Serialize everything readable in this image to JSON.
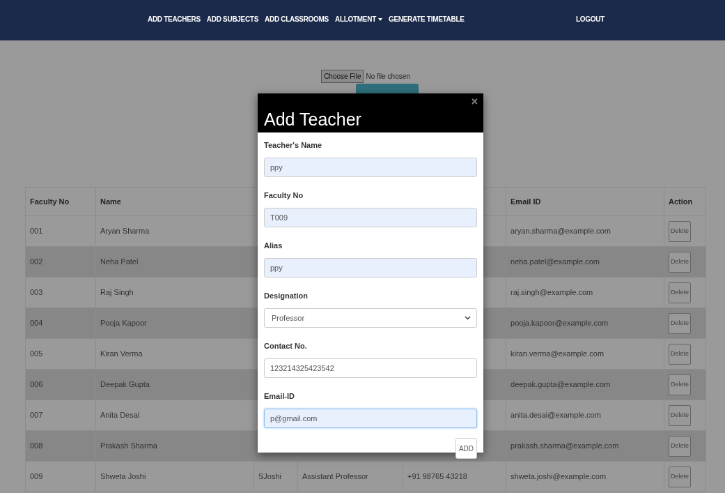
{
  "nav": {
    "items": [
      {
        "label": "ADD TEACHERS",
        "dropdown": false
      },
      {
        "label": "ADD SUBJECTS",
        "dropdown": false
      },
      {
        "label": "ADD CLASSROOMS",
        "dropdown": false
      },
      {
        "label": "ALLOTMENT",
        "dropdown": true
      },
      {
        "label": "GENERATE TIMETABLE",
        "dropdown": false
      }
    ],
    "logout": "LOGOUT"
  },
  "file_upload": {
    "button": "Choose File",
    "status": "No file chosen"
  },
  "table": {
    "columns": [
      "Faculty No",
      "Name",
      "Email ID",
      "Action"
    ],
    "rows": [
      {
        "faculty_no": "001",
        "name": "Aryan Sharma",
        "email": "aryan.sharma@example.com",
        "action": "Delete"
      },
      {
        "faculty_no": "002",
        "name": "Neha Patel",
        "email": "neha.patel@example.com",
        "action": "Delete"
      },
      {
        "faculty_no": "003",
        "name": "Raj Singh",
        "email": "raj.singh@example.com",
        "action": "Delete"
      },
      {
        "faculty_no": "004",
        "name": "Pooja Kapoor",
        "email": "pooja.kapoor@example.com",
        "action": "Delete"
      },
      {
        "faculty_no": "005",
        "name": "Kiran Verma",
        "email": "kiran.verma@example.com",
        "action": "Delete"
      },
      {
        "faculty_no": "006",
        "name": "Deepak Gupta",
        "email": "deepak.gupta@example.com",
        "action": "Delete"
      },
      {
        "faculty_no": "007",
        "name": "Anita Desai",
        "email": "anita.desai@example.com",
        "action": "Delete"
      },
      {
        "faculty_no": "008",
        "name": "Prakash Sharma",
        "email": "prakash.sharma@example.com",
        "action": "Delete"
      },
      {
        "faculty_no": "009",
        "name": "Shweta Joshi",
        "alias": "SJoshi",
        "designation": "Assistant Professor",
        "contact": "+91 98765 43218",
        "email": "shweta.joshi@example.com",
        "action": "Delete"
      }
    ]
  },
  "modal": {
    "title": "Add Teacher",
    "close": "×",
    "fields": [
      {
        "kind": "text",
        "label": "Teacher's Name",
        "value": "ppy",
        "autofilled": true,
        "focused": false
      },
      {
        "kind": "text",
        "label": "Faculty No",
        "value": "T009",
        "autofilled": true,
        "focused": false
      },
      {
        "kind": "text",
        "label": "Alias",
        "value": "ppy",
        "autofilled": true,
        "focused": false
      },
      {
        "kind": "select",
        "label": "Designation",
        "value": "Professor",
        "autofilled": false,
        "focused": false
      },
      {
        "kind": "text",
        "label": "Contact No.",
        "value": "123214325423542",
        "autofilled": false,
        "focused": false
      },
      {
        "kind": "text",
        "label": "Email-ID",
        "value": "p@gmail.com",
        "autofilled": true,
        "focused": true
      }
    ],
    "submit": "ADD"
  }
}
